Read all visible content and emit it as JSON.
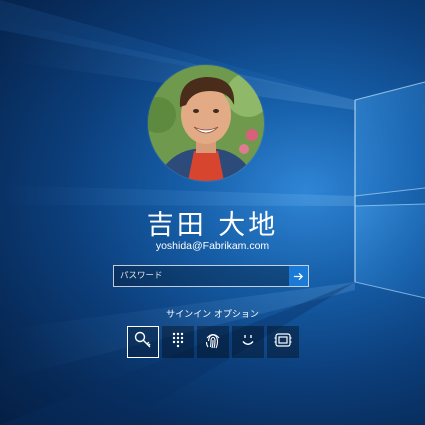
{
  "user": {
    "name": "吉田 大地",
    "email": "yoshida@Fabrikam.com"
  },
  "password": {
    "placeholder": "パスワード",
    "value": "",
    "submit_icon": "arrow-right-icon"
  },
  "signin_options": {
    "label": "サインイン オプション",
    "selected": "key-icon",
    "items": [
      {
        "icon": "key-icon"
      },
      {
        "icon": "pin-keypad-icon"
      },
      {
        "icon": "fingerprint-icon"
      },
      {
        "icon": "face-icon"
      },
      {
        "icon": "security-key-icon"
      }
    ]
  },
  "colors": {
    "accent": "#1a7ad6",
    "background": "#0c3f7c"
  }
}
